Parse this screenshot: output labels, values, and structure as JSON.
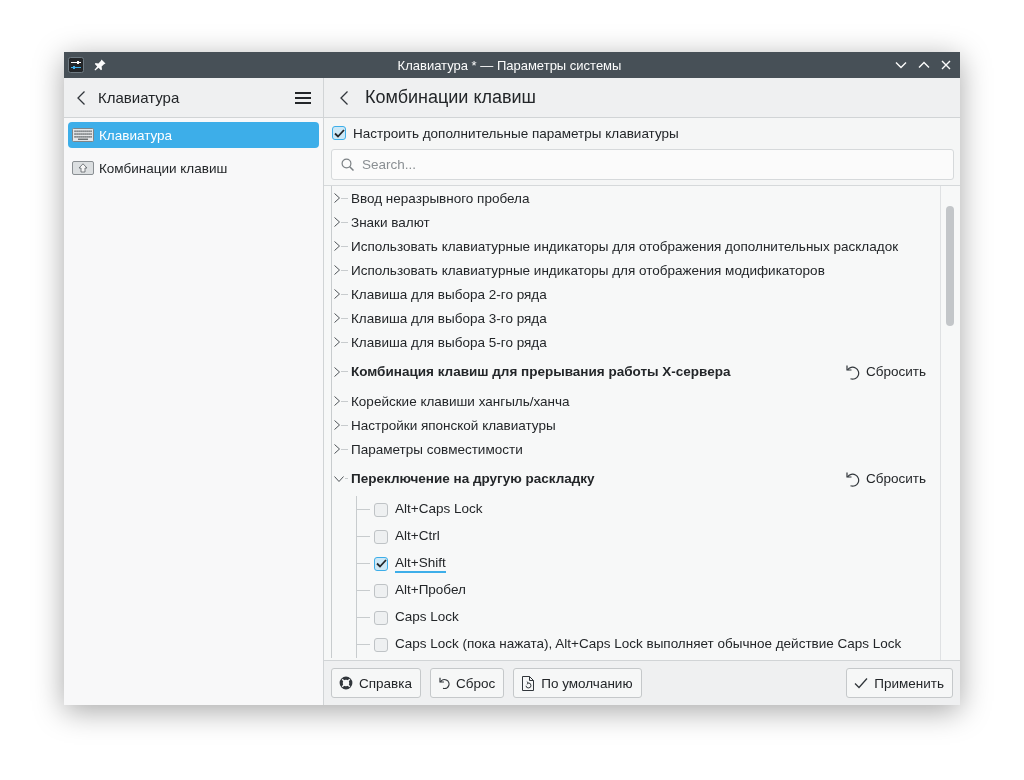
{
  "window": {
    "title": "Клавиатура * — Параметры системы"
  },
  "sidebar": {
    "title": "Клавиатура",
    "items": [
      {
        "label": "Клавиатура",
        "selected": true
      },
      {
        "label": "Комбинации клавиш",
        "selected": false
      }
    ]
  },
  "page": {
    "title": "Комбинации клавиш",
    "advanced": {
      "label": "Настроить дополнительные параметры клавиатуры",
      "checked": true
    },
    "search": {
      "placeholder": "Search..."
    },
    "options": [
      {
        "label": "Ввод неразрывного пробела",
        "expanded": false,
        "modified": false
      },
      {
        "label": "Знаки валют",
        "expanded": false,
        "modified": false
      },
      {
        "label": "Использовать клавиатурные индикаторы для отображения дополнительных раскладок",
        "expanded": false,
        "modified": false
      },
      {
        "label": "Использовать клавиатурные индикаторы для отображения модификаторов",
        "expanded": false,
        "modified": false
      },
      {
        "label": "Клавиша для выбора 2-го ряда",
        "expanded": false,
        "modified": false
      },
      {
        "label": "Клавиша для выбора 3-го ряда",
        "expanded": false,
        "modified": false
      },
      {
        "label": "Клавиша для выбора 5-го ряда",
        "expanded": false,
        "modified": false
      },
      {
        "label": "Комбинация клавиш для прерывания работы X-сервера",
        "expanded": false,
        "modified": true,
        "reset_label": "Сбросить"
      },
      {
        "label": "Корейские клавиши хангыль/ханча",
        "expanded": false,
        "modified": false
      },
      {
        "label": "Настройки японской клавиатуры",
        "expanded": false,
        "modified": false
      },
      {
        "label": "Параметры совместимости",
        "expanded": false,
        "modified": false
      },
      {
        "label": "Переключение на другую раскладку",
        "expanded": true,
        "modified": true,
        "reset_label": "Сбросить",
        "children": [
          {
            "label": "Alt+Caps Lock",
            "checked": false,
            "focused": false
          },
          {
            "label": "Alt+Ctrl",
            "checked": false,
            "focused": false
          },
          {
            "label": "Alt+Shift",
            "checked": true,
            "focused": true
          },
          {
            "label": "Alt+Пробел",
            "checked": false,
            "focused": false
          },
          {
            "label": "Caps Lock",
            "checked": false,
            "focused": false
          },
          {
            "label": "Caps Lock (пока нажата), Alt+Caps Lock выполняет обычное действие Caps Lock",
            "checked": false,
            "focused": false
          }
        ]
      }
    ]
  },
  "footer": {
    "left_buttons": [
      {
        "label": "Справка"
      },
      {
        "label": "Сброс"
      },
      {
        "label": "По умолчанию"
      }
    ],
    "right_buttons": [
      {
        "label": "Применить"
      }
    ]
  }
}
